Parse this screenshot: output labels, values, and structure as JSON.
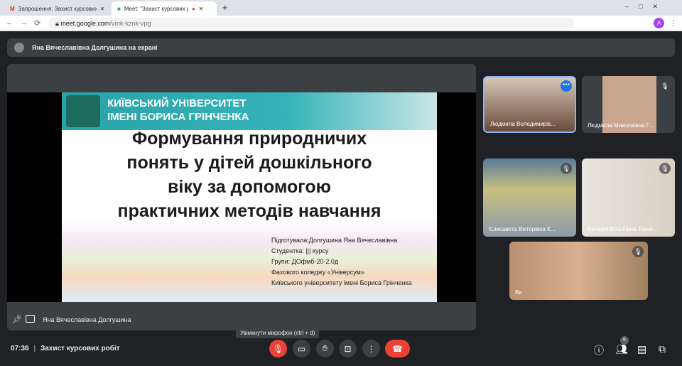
{
  "browser": {
    "tabs": [
      {
        "label": "Запрошення: Захист курсових р",
        "icon": "gmail-icon"
      },
      {
        "label": "Meet: \"Захист курсових робі",
        "icon": "meet-icon",
        "recording": true
      }
    ],
    "url_host": "meet.google.com",
    "url_path": "/vmk-kznk-vpg",
    "profile": "A"
  },
  "banner": {
    "text": "Яна Вячеславівна Долгушина на екрані"
  },
  "slide": {
    "university_line1": "КИЇВСЬКИЙ УНІВЕРСИТЕТ",
    "university_line2": "ІМЕНІ БОРИСА ГРІНЧЕНКА",
    "title_lines": [
      "Формування природничих",
      "понять у дітей дошкільного",
      "віку за допомогою",
      "практичних методів навчання"
    ],
    "info_lines": [
      "Підготувала:Долгушина Яна Вячеславівна",
      "Студентка: ||| курсу",
      "Групи:  ДОфмб-20-2.0д",
      "Фахового коледжу «Універсум»",
      "Київського університету імені Бориса Грінченка"
    ]
  },
  "presenter": {
    "name": "Яна Вячеславівна Долгушина"
  },
  "participants": [
    {
      "name": "Людмила Володимирів...",
      "muted": false
    },
    {
      "name": "Людмила Миколаївна Г...",
      "muted": true
    },
    {
      "name": "Єлисавета Вікторівна К...",
      "muted": true
    },
    {
      "name": "Валерія Віталіївна Ткачо...",
      "muted": true
    },
    {
      "name": "Ви",
      "muted": true
    }
  ],
  "tooltip": "Увімкнути мікрофон (ctrl + d)",
  "meeting": {
    "time": "07:36",
    "title": "Захист курсових робіт",
    "participant_count": "6"
  },
  "colors": {
    "background": "#202124",
    "tile": "#3c4043",
    "danger": "#ea4335",
    "accent": "#8ab4f8"
  }
}
